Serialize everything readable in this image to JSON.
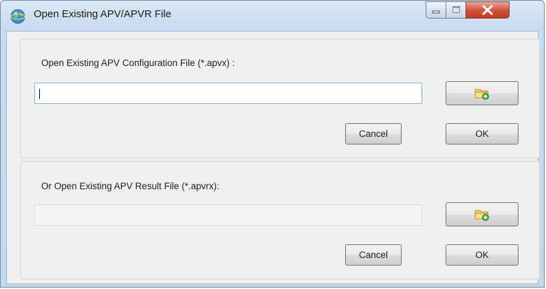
{
  "window": {
    "title": "Open Existing APV/APVR File",
    "icon": "globe-icon",
    "controls": [
      "minimize-icon",
      "maximize-icon",
      "close-icon"
    ]
  },
  "config_section": {
    "label": "Open Existing APV Configuration File (*.apvx) :",
    "path_value": "",
    "path_placeholder": "",
    "browse_icon": "folder-add-icon",
    "cancel_label": "Cancel",
    "ok_label": "OK"
  },
  "result_section": {
    "label": "Or Open Existing APV Result File (*.apvrx):",
    "path_value": "",
    "path_placeholder": "",
    "browse_icon": "folder-add-icon",
    "cancel_label": "Cancel",
    "ok_label": "OK"
  }
}
